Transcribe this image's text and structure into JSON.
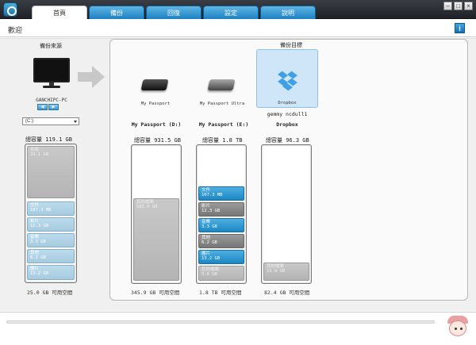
{
  "tabs": [
    {
      "label": "首頁",
      "active": true
    },
    {
      "label": "備份",
      "active": false
    },
    {
      "label": "回復",
      "active": false
    },
    {
      "label": "設定",
      "active": false
    },
    {
      "label": "說明",
      "active": false
    }
  ],
  "window_buttons": {
    "minimize": "–",
    "maximize": "□",
    "close": "×"
  },
  "header": {
    "title": "歡迎",
    "info_label": "i"
  },
  "source": {
    "title": "備份來源",
    "pc_name": "GANCHIPC-PC",
    "mini_buttons": [
      "◀",
      "▶"
    ],
    "drive_select": "(C:)",
    "capacity_label": "總容量 119.1 GB",
    "segments": [
      {
        "name": "系統",
        "size": "39.1 GB",
        "color": "gray"
      },
      {
        "name": "文件",
        "size": "107.3 MB",
        "color": "lblue"
      },
      {
        "name": "影片",
        "size": "12.3 GB",
        "color": "lblue"
      },
      {
        "name": "音樂",
        "size": "3.3 GB",
        "color": "lblue"
      },
      {
        "name": "其他",
        "size": "6.2 GB",
        "color": "lblue"
      },
      {
        "name": "圖片",
        "size": "13.2 GB",
        "color": "lblue"
      }
    ],
    "free_label": "25.0 GB 可用空間"
  },
  "destination": {
    "title": "備份目標",
    "devices": [
      {
        "name": "My Passport",
        "selected": false,
        "icon": "external-drive-icon"
      },
      {
        "name": "My Passport Ultra",
        "selected": false,
        "icon": "external-drive-icon"
      },
      {
        "name": "Dropbox",
        "selected": true,
        "icon": "dropbox-icon"
      }
    ],
    "dropbox_user": "gemmy ncdull1",
    "drives": [
      {
        "subtitle": "My Passport (D:)",
        "capacity_label": "總容量 931.5 GB",
        "segments": [
          {
            "name": "其他檔案",
            "size": "585.6 GB",
            "color": "gray"
          }
        ],
        "free_label": "345.9 GB 可用空間"
      },
      {
        "subtitle": "My Passport (E:)",
        "capacity_label": "總容量 1.8 TB",
        "segments": [
          {
            "name": "文件",
            "size": "107.3 MB",
            "color": "blue"
          },
          {
            "name": "影片",
            "size": "12.3 GB",
            "color": "darkgray"
          },
          {
            "name": "音樂",
            "size": "3.3 GB",
            "color": "blue"
          },
          {
            "name": "其他",
            "size": "6.2 GB",
            "color": "darkgray"
          },
          {
            "name": "圖片",
            "size": "13.2 GB",
            "color": "blue"
          },
          {
            "name": "其他檔案",
            "size": "3.6 GB",
            "color": "gray"
          }
        ],
        "free_label": "1.8 TB 可用空間"
      },
      {
        "subtitle": "Dropbox",
        "capacity_label": "總容量 96.3 GB",
        "segments": [
          {
            "name": "其他檔案",
            "size": "13.9 GB",
            "color": "gray"
          }
        ],
        "free_label": "82.4 GB 可用空間"
      }
    ]
  }
}
